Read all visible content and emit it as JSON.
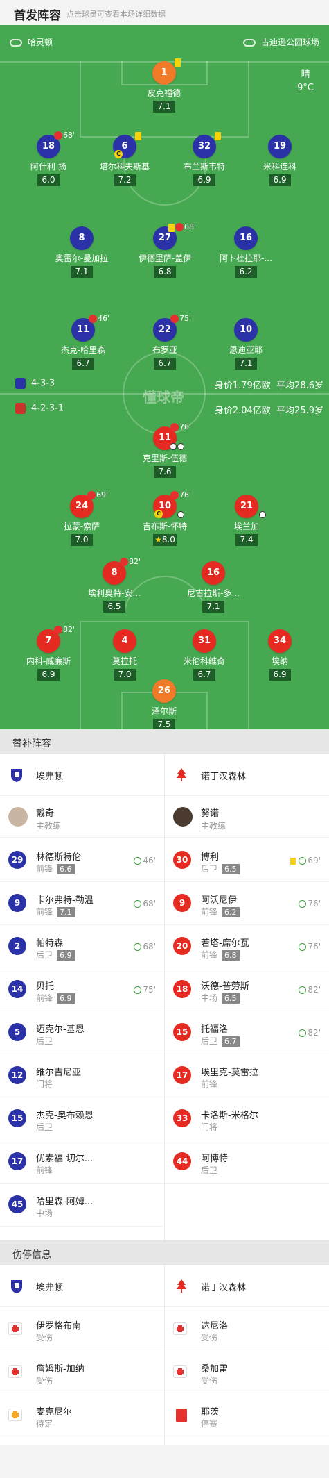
{
  "header": {
    "title": "首发阵容",
    "subtitle": "点击球员可查看本场详细数据"
  },
  "pitch": {
    "referee": "哈灵顿",
    "stadium": "古迪逊公园球场",
    "weather": "晴",
    "temperature": "9°C",
    "watermark": "懂球帝",
    "home": {
      "formation": "4-3-3",
      "value": "身价1.79亿欧",
      "age": "平均28.6岁"
    },
    "away": {
      "formation": "4-2-3-1",
      "value": "身价2.04亿欧",
      "age": "平均25.9岁"
    },
    "home_players": [
      {
        "num": "1",
        "name": "皮克福德",
        "rating": "7.1"
      },
      {
        "num": "18",
        "name": "阿什利-扬",
        "rating": "6.0",
        "sub": "68'"
      },
      {
        "num": "6",
        "name": "塔尔科夫斯基",
        "rating": "7.2"
      },
      {
        "num": "32",
        "name": "布兰斯韦特",
        "rating": "6.9"
      },
      {
        "num": "19",
        "name": "米科连科",
        "rating": "6.9"
      },
      {
        "num": "8",
        "name": "奥雷尔-曼加拉",
        "rating": "7.1"
      },
      {
        "num": "27",
        "name": "伊德里萨-盖伊",
        "rating": "6.8",
        "sub": "68'"
      },
      {
        "num": "16",
        "name": "阿卜杜拉耶-...",
        "rating": "6.2"
      },
      {
        "num": "11",
        "name": "杰克-哈里森",
        "rating": "6.7",
        "sub": "46'"
      },
      {
        "num": "22",
        "name": "布罗亚",
        "rating": "6.7",
        "sub": "75'"
      },
      {
        "num": "10",
        "name": "恩迪亚耶",
        "rating": "7.1"
      }
    ],
    "away_players": [
      {
        "num": "11",
        "name": "克里斯-伍德",
        "rating": "7.6",
        "sub": "76'"
      },
      {
        "num": "24",
        "name": "拉蒙-索萨",
        "rating": "7.0",
        "sub": "69'"
      },
      {
        "num": "10",
        "name": "吉布斯-怀特",
        "rating": "8.0",
        "sub": "76'"
      },
      {
        "num": "21",
        "name": "埃兰加",
        "rating": "7.4"
      },
      {
        "num": "8",
        "name": "埃利奥特-安...",
        "rating": "6.5",
        "sub": "82'"
      },
      {
        "num": "16",
        "name": "尼古拉斯-多...",
        "rating": "7.1"
      },
      {
        "num": "7",
        "name": "内科-威廉斯",
        "rating": "6.9",
        "sub": "82'"
      },
      {
        "num": "4",
        "name": "莫拉托",
        "rating": "7.0"
      },
      {
        "num": "31",
        "name": "米伦科维奇",
        "rating": "6.7"
      },
      {
        "num": "34",
        "name": "埃纳",
        "rating": "6.9"
      },
      {
        "num": "26",
        "name": "泽尔斯",
        "rating": "7.5"
      }
    ]
  },
  "subs_section": {
    "title": "替补阵容",
    "home_club": "埃弗顿",
    "away_club": "诺丁汉森林",
    "home_coach": {
      "name": "戴奇",
      "role": "主教练"
    },
    "away_coach": {
      "name": "努诺",
      "role": "主教练"
    },
    "home_subs": [
      {
        "num": "29",
        "name": "林德斯特伦",
        "pos": "前锋",
        "rating": "6.6",
        "time": "46'"
      },
      {
        "num": "9",
        "name": "卡尔弗特-勒温",
        "pos": "前锋",
        "rating": "7.1",
        "time": "68'"
      },
      {
        "num": "2",
        "name": "帕特森",
        "pos": "后卫",
        "rating": "6.9",
        "time": "68'"
      },
      {
        "num": "14",
        "name": "贝托",
        "pos": "前锋",
        "rating": "6.9",
        "time": "75'"
      },
      {
        "num": "5",
        "name": "迈克尔-基恩",
        "pos": "后卫"
      },
      {
        "num": "12",
        "name": "维尔吉尼亚",
        "pos": "门将"
      },
      {
        "num": "15",
        "name": "杰克-奥布赖恩",
        "pos": "后卫"
      },
      {
        "num": "17",
        "name": "优素福-切尔...",
        "pos": "前锋"
      },
      {
        "num": "45",
        "name": "哈里森-阿姆...",
        "pos": "中场"
      }
    ],
    "away_subs": [
      {
        "num": "30",
        "name": "博利",
        "pos": "后卫",
        "rating": "6.5",
        "time": "69'",
        "card": true
      },
      {
        "num": "9",
        "name": "阿沃尼伊",
        "pos": "前锋",
        "rating": "6.2",
        "time": "76'"
      },
      {
        "num": "20",
        "name": "若塔-席尔瓦",
        "pos": "前锋",
        "rating": "6.8",
        "time": "76'"
      },
      {
        "num": "18",
        "name": "沃德-普劳斯",
        "pos": "中场",
        "rating": "6.5",
        "time": "82'"
      },
      {
        "num": "15",
        "name": "托福洛",
        "pos": "后卫",
        "rating": "6.7",
        "time": "82'"
      },
      {
        "num": "17",
        "name": "埃里克-莫雷拉",
        "pos": "前锋"
      },
      {
        "num": "33",
        "name": "卡洛斯-米格尔",
        "pos": "门将"
      },
      {
        "num": "44",
        "name": "阿博特",
        "pos": "后卫"
      }
    ]
  },
  "injury_section": {
    "title": "伤停信息",
    "home_club": "埃弗顿",
    "away_club": "诺丁汉森林",
    "home": [
      {
        "name": "伊罗格布南",
        "status": "受伤"
      },
      {
        "name": "詹姆斯-加纳",
        "status": "受伤"
      },
      {
        "name": "麦克尼尔",
        "status": "待定"
      }
    ],
    "away": [
      {
        "name": "达尼洛",
        "status": "受伤"
      },
      {
        "name": "桑加雷",
        "status": "受伤"
      },
      {
        "name": "耶茨",
        "status": "停赛"
      }
    ]
  },
  "colors": {
    "pitch": "#46a951",
    "home": "#2b32a8",
    "away": "#e52a22",
    "keeper": "#f07a28"
  }
}
